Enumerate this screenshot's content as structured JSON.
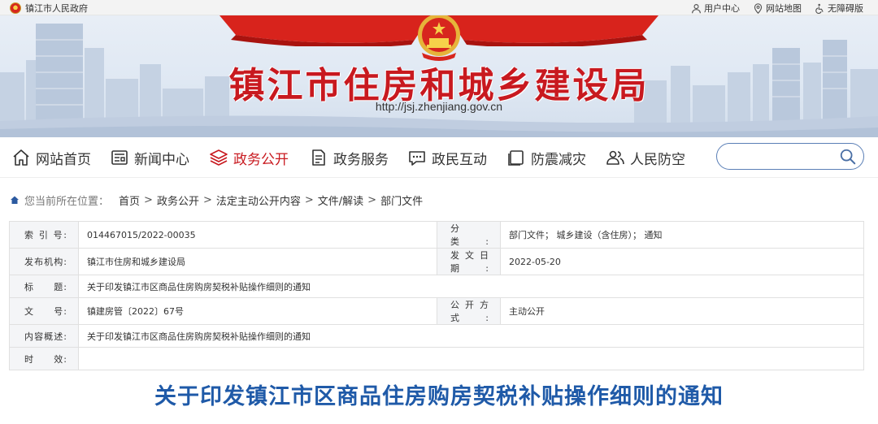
{
  "topbar": {
    "site_name": "镇江市人民政府",
    "links": [
      {
        "icon": "user-icon",
        "label": "用户中心"
      },
      {
        "icon": "map-pin-icon",
        "label": "网站地图"
      },
      {
        "icon": "accessibility-icon",
        "label": "无障碍版"
      }
    ]
  },
  "banner": {
    "title": "镇江市住房和城乡建设局",
    "url": "http://jsj.zhenjiang.gov.cn"
  },
  "nav": {
    "items": [
      {
        "icon": "home-icon",
        "label": "网站首页"
      },
      {
        "icon": "news-icon",
        "label": "新闻中心"
      },
      {
        "icon": "layers-icon",
        "label": "政务公开"
      },
      {
        "icon": "document-icon",
        "label": "政务服务"
      },
      {
        "icon": "chat-icon",
        "label": "政民互动"
      },
      {
        "icon": "window-icon",
        "label": "防震减灾"
      },
      {
        "icon": "people-icon",
        "label": "人民防空"
      }
    ],
    "active_index": 2,
    "search_placeholder": ""
  },
  "breadcrumb": {
    "prefix": "您当前所在位置：",
    "items": [
      "首页",
      "政务公开",
      "法定主动公开内容",
      "文件/解读",
      "部门文件"
    ]
  },
  "meta": {
    "index_label": "索 引 号:",
    "index_value": "014467015/2022-00035",
    "category_label": "分　　类:",
    "category_value": "部门文件；   城乡建设（含住房）；  通知",
    "publisher_label": "发布机构:",
    "publisher_value": "镇江市住房和城乡建设局",
    "date_label": "发文日期:",
    "date_value": "2022-05-20",
    "title_label": "标　　题:",
    "title_value": "关于印发镇江市区商品住房购房契税补贴操作细则的通知",
    "docno_label": "文　　号:",
    "docno_value": "镇建房管〔2022〕67号",
    "disclosure_label": "公开方式:",
    "disclosure_value": "主动公开",
    "summary_label": "内容概述:",
    "summary_value": "关于印发镇江市区商品住房购房契税补贴操作细则的通知",
    "validity_label": "时　　效:",
    "validity_value": ""
  },
  "document": {
    "title": "关于印发镇江市区商品住房购房契税补贴操作细则的通知"
  },
  "colors": {
    "brand_red": "#c8191f",
    "title_blue": "#1f5aa8",
    "nav_active": "#c8191f"
  }
}
